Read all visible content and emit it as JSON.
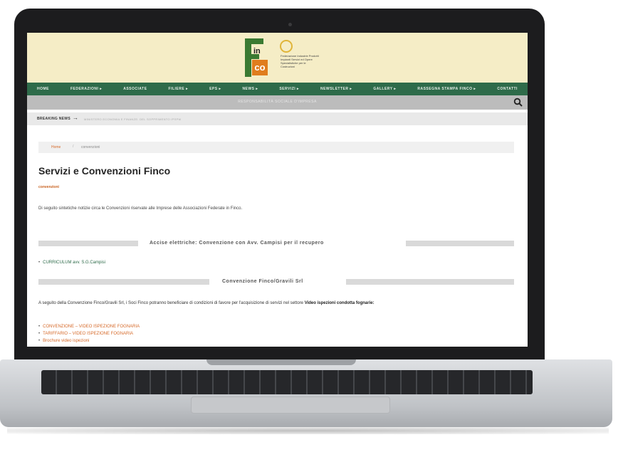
{
  "site": {
    "logo": {
      "letters": "in",
      "letters2": "co",
      "tagline": "Federazione Industrie Prodotti Impianti Servizi ed Opere Specialistiche per le Costruzioni"
    }
  },
  "nav": {
    "items": [
      "HOME",
      "FEDERAZIONI ▸",
      "ASSOCIATE",
      "FILIERE ▸",
      "EPS ▸",
      "NEWS ▸",
      "SERVIZI ▸",
      "NEWSLETTER ▸",
      "GALLERY ▸",
      "RASSEGNA STAMPA FINCO ▸",
      "CONTATTI"
    ]
  },
  "subbar": {
    "title": "RESPONSABILITÀ SOCIALE D'IMPRESA"
  },
  "breaking": {
    "label": "BREAKING NEWS",
    "arrow": "→",
    "text": "MINISTERO ECONOMIA E FINANZE: DEL SOPPRIMENTO IPSPM"
  },
  "breadcrumb": {
    "home": "Home",
    "sep": "/",
    "current": "convenzioni"
  },
  "page": {
    "title": "Servizi e Convenzioni Finco",
    "category": "convenzioni",
    "intro": "Di seguito sintetiche notizie circa le Convenzioni riservate alle Imprese delle Associazioni Federate in Finco."
  },
  "sections": [
    {
      "title": "Accise elettriche: Convenzione con Avv. Campisi per il recupero"
    },
    {
      "title": "Convenzione Finco/Gravili Srl"
    }
  ],
  "section1_items": [
    "CURRICULUM avv. S.G.Campisi"
  ],
  "section2": {
    "text_before": "A seguito della Convenzione Finco/Gravili Srl, i Soci Finco potranno beneficiare di condizioni di favore per l'acquisizione di servizi  nel settore ",
    "text_bold": "Video ispezioni condotta fognarie:",
    "links": [
      "CONVENZIONE – VIDEO ISPEZIONE FOGNARIA",
      "TARIFFARIO – VIDEO ISPEZIONE FOGNARIA",
      "Brochure video ispezioni"
    ]
  },
  "colors": {
    "nav": "#2e6b4a",
    "header": "#f5edc6",
    "accent": "#d66a2a"
  }
}
